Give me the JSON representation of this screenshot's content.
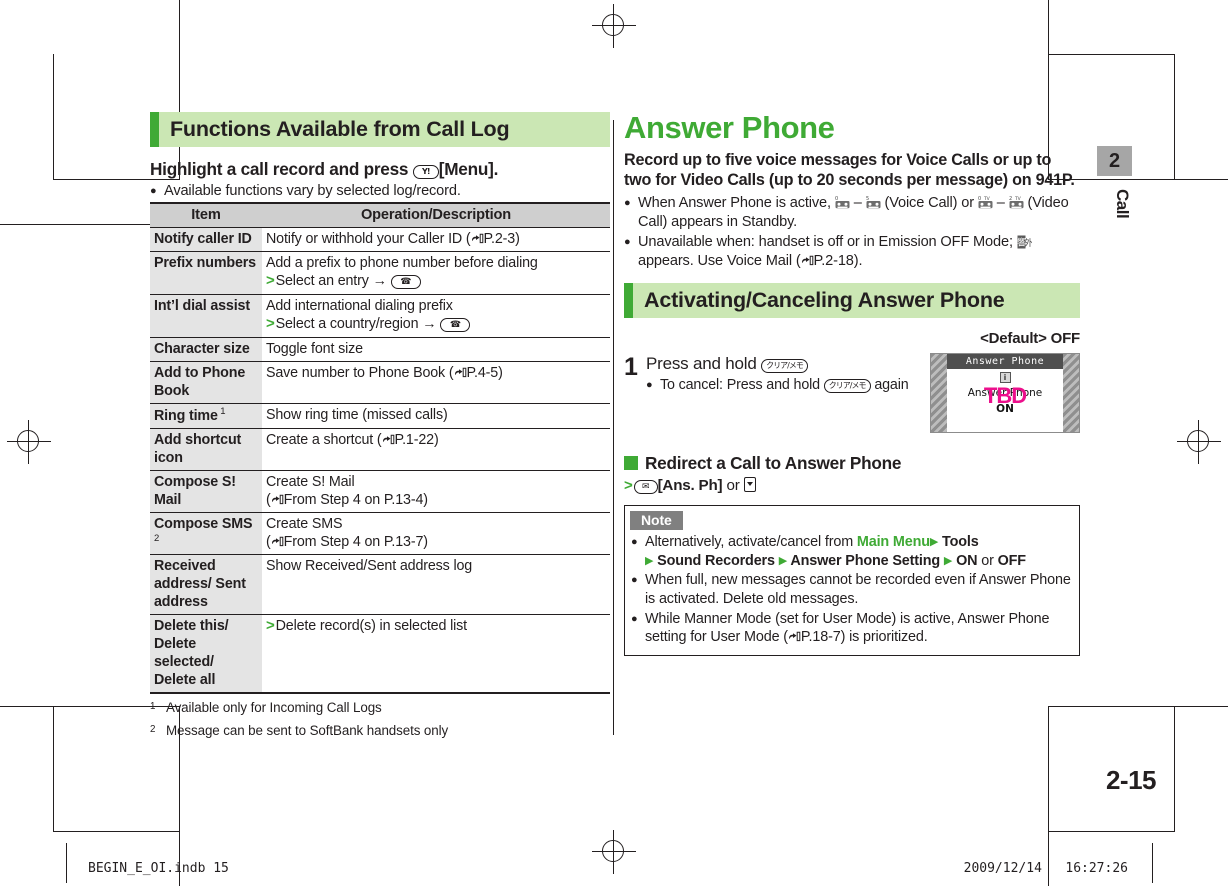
{
  "left_column": {
    "section_heading": "Functions Available from Call Log",
    "intro_bold": "Highlight a call record and press",
    "intro_key": "Y!",
    "intro_bold_tail": "[Menu].",
    "intro_bullet": "Available functions vary by selected log/record.",
    "table": {
      "headers": [
        "Item",
        "Operation/Description"
      ],
      "rows": [
        {
          "item": "Notify caller ID",
          "item_sup": "",
          "lines": [
            {
              "text": "Notify or withhold your Caller ID (",
              "ref": "P.2-3",
              "tail": ")",
              "marker": "none"
            }
          ]
        },
        {
          "item": "Prefix numbers",
          "item_sup": "",
          "lines": [
            {
              "text": "Add a prefix to phone number before dialing",
              "marker": "none"
            },
            {
              "text": "Select an entry →",
              "marker": "gt",
              "key": "call"
            }
          ]
        },
        {
          "item": "Int’l dial assist",
          "item_sup": "",
          "lines": [
            {
              "text": "Add international dialing prefix",
              "marker": "none"
            },
            {
              "text": "Select a country/region →",
              "marker": "gt",
              "key": "call"
            }
          ]
        },
        {
          "item": "Character size",
          "item_sup": "",
          "lines": [
            {
              "text": "Toggle font size",
              "marker": "none"
            }
          ]
        },
        {
          "item": "Add to Phone Book",
          "item_sup": "",
          "lines": [
            {
              "text": "Save number to Phone Book (",
              "ref": "P.4-5",
              "tail": ")",
              "marker": "none"
            }
          ]
        },
        {
          "item": "Ring time",
          "item_sup": "1",
          "lines": [
            {
              "text": "Show ring time  (missed calls)",
              "marker": "none"
            }
          ]
        },
        {
          "item": "Add shortcut icon",
          "item_sup": "",
          "lines": [
            {
              "text": "Create a shortcut (",
              "ref": "P.1-22",
              "tail": ")",
              "marker": "none"
            }
          ]
        },
        {
          "item": "Compose S! Mail",
          "item_sup": "",
          "lines": [
            {
              "text": "Create S! Mail",
              "marker": "none"
            },
            {
              "text": "(",
              "ref": "From Step 4 on P.13-4",
              "tail": ")",
              "marker": "none"
            }
          ]
        },
        {
          "item": "Compose SMS",
          "item_sup": "2",
          "lines": [
            {
              "text": "Create SMS",
              "marker": "none"
            },
            {
              "text": "(",
              "ref": "From Step 4 on P.13-7",
              "tail": ")",
              "marker": "none"
            }
          ]
        },
        {
          "item": "Received address/ Sent address",
          "item_sup": "",
          "lines": [
            {
              "text": "Show Received/Sent address log",
              "marker": "none"
            }
          ]
        },
        {
          "item": "Delete this/ Delete selected/ Delete all",
          "item_sup": "",
          "lines": [
            {
              "text": "Delete record(s) in selected list",
              "marker": "gt"
            }
          ]
        }
      ]
    },
    "footnotes": [
      {
        "num": "1",
        "text": "Available only for Incoming Call Logs"
      },
      {
        "num": "2",
        "text": "Message can be sent to SoftBank handsets only"
      }
    ]
  },
  "right_column": {
    "title": "Answer Phone",
    "lede_line1": "Record up to five voice messages for Voice Calls or up to",
    "lede_line2": "two for Video Calls (up to 20 seconds per message) on 941P.",
    "bullets": [
      {
        "parts": [
          {
            "t": "When Answer Phone is active, "
          },
          {
            "icon": "tape-0"
          },
          {
            "t": " – "
          },
          {
            "icon": "tape-5"
          },
          {
            "t": " (Voice Call) or "
          },
          {
            "icon": "tape-0-tv"
          },
          {
            "t": " – "
          },
          {
            "icon": "tape-2-tv"
          },
          {
            "t": " (Video Call) appears in Standby."
          }
        ]
      },
      {
        "parts": [
          {
            "t": "Unavailable when: handset is off or in Emission OFF Mode; "
          },
          {
            "icon": "emission-off"
          },
          {
            "t": " appears. Use Voice Mail ("
          },
          {
            "ref": "P.2-18"
          },
          {
            "t": ")."
          }
        ]
      }
    ],
    "section_heading": "Activating/Canceling Answer Phone",
    "default_label": "<Default> OFF",
    "step": {
      "number": "1",
      "title_pre": "Press and hold",
      "title_key": "クリア/メモ",
      "bullet_pre": "To cancel: Press and hold",
      "bullet_key": "クリア/メモ",
      "bullet_post": "again"
    },
    "screenshot": {
      "title": "Answer Phone",
      "info_glyph": "i",
      "body_text": "Answer Phone",
      "overlay": "TBD",
      "status": "ON"
    },
    "redirect": {
      "heading": "Redirect a Call to Answer Phone",
      "marker": ">",
      "key": "mail-icon",
      "label": "[Ans. Ph]",
      "or": "or"
    },
    "note": {
      "tab_label": "Note",
      "items": [
        {
          "parts": [
            {
              "t": "Alternatively, activate/cancel from "
            },
            {
              "g": "Main Menu"
            },
            {
              "tri": true
            },
            {
              "b": " Tools"
            },
            {
              "br": true
            },
            {
              "tri": true
            },
            {
              "b": " Sound Recorders "
            },
            {
              "tri": true
            },
            {
              "b": " Answer Phone Setting "
            },
            {
              "tri": true
            },
            {
              "b": " ON"
            },
            {
              "t": " or "
            },
            {
              "b": "OFF"
            }
          ]
        },
        {
          "parts": [
            {
              "t": "When full, new messages cannot be recorded even if Answer Phone is activated. Delete old messages."
            }
          ]
        },
        {
          "parts": [
            {
              "t": "While Manner Mode (set for User Mode) is active, Answer Phone setting for User Mode ("
            },
            {
              "ref": "P.18-7"
            },
            {
              "t": ") is prioritized."
            }
          ]
        }
      ]
    }
  },
  "side_tab": {
    "chapter_number": "2",
    "chapter_label": "Call"
  },
  "page_number": "2-15",
  "footer": {
    "left": "BEGIN_E_OI.indb   15",
    "right": "2009/12/14   16:27:26"
  },
  "colors": {
    "accent_green": "#3faa35",
    "heading_bg": "#cbe7b4",
    "table_header_bg": "#cfcfcf",
    "table_item_bg": "#e4e4e4",
    "note_tab_bg": "#808080",
    "side_tab_bg": "#a6a6a6",
    "overlay_magenta": "#ec0f8c"
  }
}
